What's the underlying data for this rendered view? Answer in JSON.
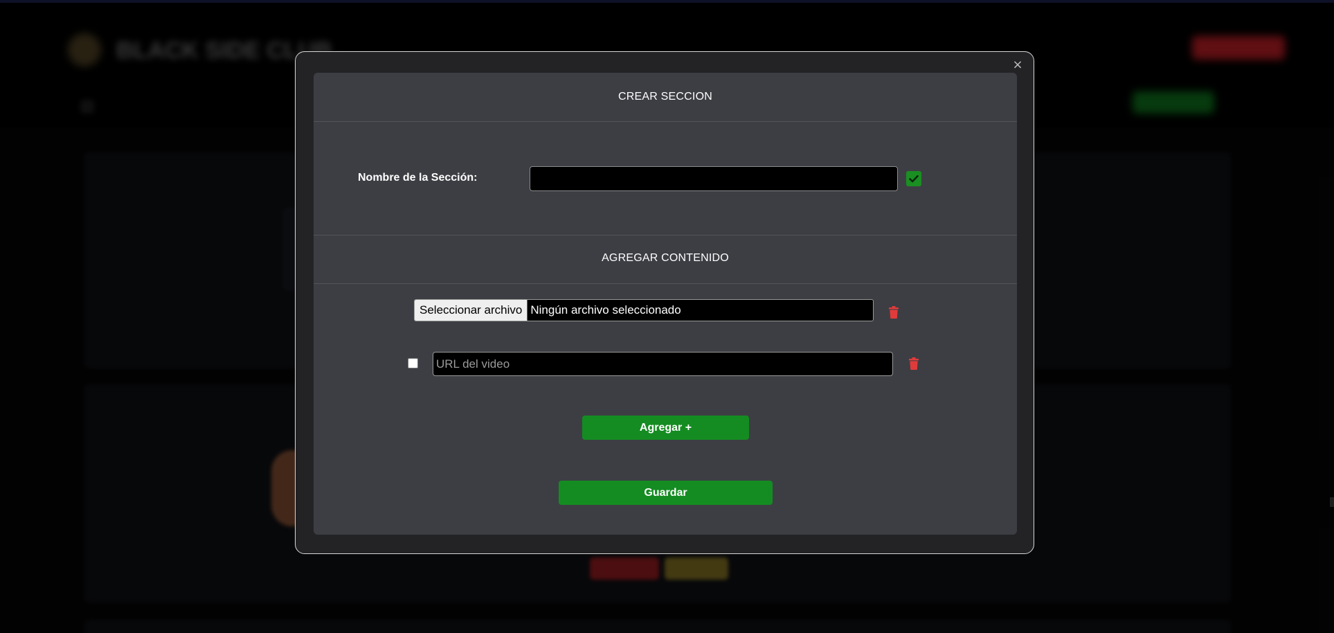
{
  "background": {
    "site_title": "BLACK SIDE CLUB"
  },
  "modal": {
    "close_label": "×",
    "crear_heading": "CREAR SECCION",
    "section_name_label": "Nombre de la Sección:",
    "section_name_value": "",
    "agregar_heading": "AGREGAR CONTENIDO",
    "file_button_label": "Seleccionar archivo",
    "file_status": "Ningún archivo seleccionado",
    "url_placeholder": "URL del video",
    "url_checkbox_checked": false,
    "agregar_button": "Agregar +",
    "guardar_button": "Guardar"
  },
  "colors": {
    "accent_green": "#148c22",
    "danger_red": "#e03b3b",
    "panel_bg": "#3d3e44",
    "modal_bg": "#232325"
  },
  "icons": {
    "confirm": "check-icon",
    "delete": "trash-icon",
    "close": "close-icon"
  }
}
